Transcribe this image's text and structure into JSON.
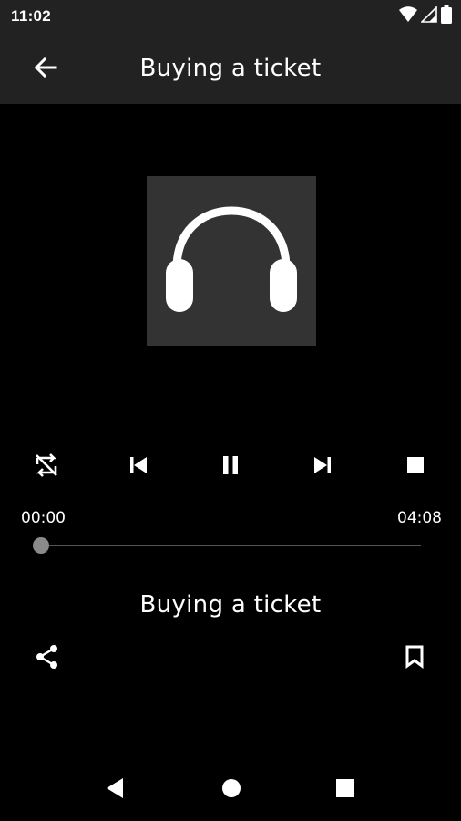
{
  "status_bar": {
    "time": "11:02",
    "icons": [
      "wifi-icon",
      "signal-icon",
      "battery-icon"
    ]
  },
  "app_bar": {
    "back_icon": "arrow-left-icon",
    "title": "Buying a ticket"
  },
  "artwork": {
    "icon": "headphones-icon",
    "background": "#333333"
  },
  "controls": {
    "items": [
      "shuffle-off-icon",
      "skip-previous-icon",
      "pause-icon",
      "skip-next-icon",
      "stop-icon"
    ]
  },
  "progress": {
    "current_time": "00:00",
    "total_time": "04:08",
    "position_fraction": 0
  },
  "track": {
    "title": "Buying a ticket"
  },
  "actions": {
    "share_icon": "share-icon",
    "bookmark_icon": "bookmark-icon"
  },
  "nav_bar": {
    "items": [
      "nav-back-icon",
      "nav-home-icon",
      "nav-recents-icon"
    ]
  },
  "colors": {
    "bar_background": "#222222",
    "page_background": "#000000",
    "foreground": "#ffffff",
    "seek_thumb": "#8a8a8a"
  }
}
